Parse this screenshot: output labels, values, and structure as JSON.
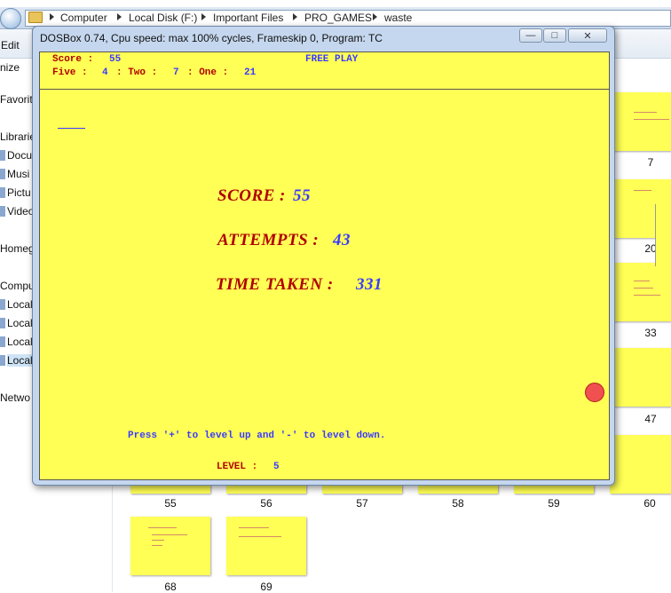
{
  "explorer": {
    "breadcrumbs": [
      "Computer",
      "Local Disk (F:)",
      "Important Files",
      "PRO_GAMES",
      "waste"
    ],
    "menu": {
      "edit": "Edit",
      "organize": "nize"
    },
    "sidebar": {
      "items": [
        "Favorit",
        "Librarie",
        "Docu",
        "Musi",
        "Pictu",
        "Video",
        "Homeg",
        "Compu",
        "Local",
        "Local",
        "Local",
        "Local",
        "Netwo"
      ]
    },
    "thumbnails": {
      "right_column": [
        "7",
        "20",
        "33",
        "47"
      ],
      "row_bottom": [
        "55",
        "56",
        "57",
        "58",
        "59",
        "60"
      ],
      "row_last": [
        "68",
        "69"
      ]
    }
  },
  "dosbox": {
    "title": "DOSBox 0.74, Cpu speed: max 100% cycles, Frameskip  0, Program:     TC",
    "controls": {
      "minimize": "—",
      "maximize": "□",
      "close": "✕"
    },
    "hud": {
      "score_label": "Score :",
      "score_value": "55",
      "mode": "FREE PLAY",
      "five_label": "Five :",
      "five_value": "4",
      "two_label": ": Two :",
      "two_value": "7",
      "one_label": ": One :",
      "one_value": "21"
    },
    "results": {
      "score_label": "SCORE :",
      "score_value": "55",
      "attempts_label": "ATTEMPTS :",
      "attempts_value": "43",
      "time_label": "TIME TAKEN :",
      "time_value": "331"
    },
    "hint": "Press '+' to level up and '-' to level down.",
    "level_label": "LEVEL :",
    "level_value": "5"
  },
  "colors": {
    "game_background": "#ffff55",
    "label_red": "#b00000",
    "value_blue": "#3a3aff",
    "ball": "#f05050"
  }
}
